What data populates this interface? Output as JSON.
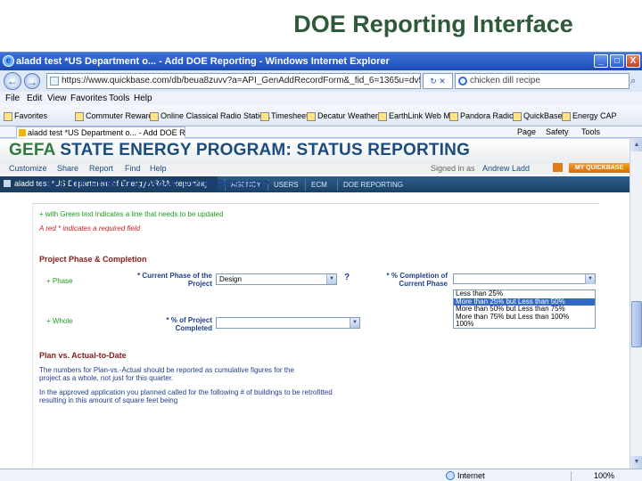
{
  "slide": {
    "title": "DOE Reporting Interface"
  },
  "window": {
    "title": "aladd test *US Department o... - Add DOE Reporting - Windows Internet Explorer",
    "minimize": "_",
    "maximize": "□",
    "close": "X"
  },
  "address": {
    "url": "https://www.quickbase.com/db/beua8zuvv?a=API_GenAddRecordForm&_fid_6=1365u=dv5",
    "search_text": "chicken dill recipe",
    "back": "←",
    "forward": "→"
  },
  "menu": [
    "File",
    "Edit",
    "View",
    "Favorites",
    "Tools",
    "Help"
  ],
  "favorites": [
    {
      "label": "Favorites"
    },
    {
      "label": "Commuter Rewards"
    },
    {
      "label": "Online Classical Radio Statio..."
    },
    {
      "label": "Timesheet"
    },
    {
      "label": "Decatur Weather"
    },
    {
      "label": "EarthLink Web Mail"
    },
    {
      "label": "Pandora Radio"
    },
    {
      "label": "QuickBase"
    },
    {
      "label": "Energy CAP"
    }
  ],
  "tab": {
    "label": "aladd test *US Department o... - Add DOE Reporting",
    "commands": [
      "Page",
      "Safety",
      "Tools"
    ]
  },
  "gefa": {
    "brand": "GEFA",
    "title_rest": "STATE ENERGY PROGRAM: STATUS REPORTING",
    "nav": [
      "Customize",
      "Share",
      "Report",
      "Find",
      "Help"
    ],
    "signed_in": "Signed in as",
    "user": "Andrew Ladd",
    "my_quickbase": "MY QUICKBASE"
  },
  "app": {
    "tab_label": "aladd test *US Department of Energy ARRA Reporting",
    "nav": [
      "AGENCY",
      "USERS",
      "ECM",
      "DOE REPORTING"
    ]
  },
  "form": {
    "heading": "TELL US HOW YOU HAVE PROGRESSED?",
    "green_note": "+ with Green text indicates a line that needs to be updated",
    "red_note": "A red * indicates a required field",
    "phase_section": "Project Phase & Completion",
    "phase_label": "+ Phase",
    "current_phase_label": "* Current Phase of the Project",
    "current_phase_value": "Design",
    "help": "?",
    "pct_completion_label": "* % Completion of Current Phase",
    "pct_options": [
      "Less than 25%",
      "More than 25% but Less than 50%",
      "More than 50% but Less than 75%",
      "More than 75% but Less than 100%",
      "100%"
    ],
    "pct_selected_index": 1,
    "whole_label": "+ Whole",
    "project_completed_label": "* % of Project Completed",
    "plan_section": "Plan vs. Actual-to-Date",
    "plan_note": "The numbers for Plan-vs.-Actual should be reported as cumulative figures for the project as a whole, not just for this quarter.",
    "approved_note": "In the approved application you planned called for the following # of buildings to be retrofitted resulting in this amount of square feet being"
  },
  "status": {
    "zone": "Internet",
    "zoom": "100%"
  }
}
